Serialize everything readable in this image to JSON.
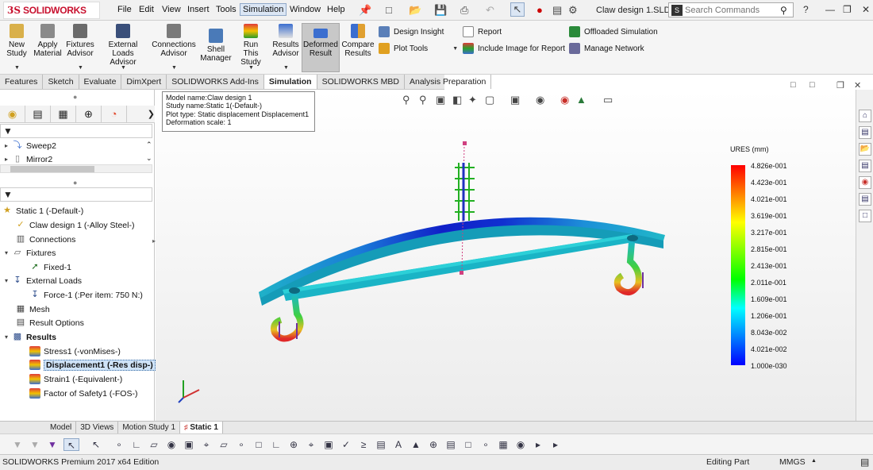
{
  "app": {
    "brand": "SOLIDWORKS",
    "brand_prefix": "3S",
    "document_title": "Claw design 1.SLD..."
  },
  "menu": [
    "File",
    "Edit",
    "View",
    "Insert",
    "Tools",
    "Simulation",
    "Window",
    "Help"
  ],
  "menu_active": "Simulation",
  "search": {
    "placeholder": "Search Commands"
  },
  "command_manager": {
    "tools": [
      {
        "label_1": "New",
        "label_2": "Study"
      },
      {
        "label_1": "Apply",
        "label_2": "Material"
      },
      {
        "label_1": "Fixtures",
        "label_2": "Advisor"
      },
      {
        "label_1": "External Loads",
        "label_2": "Advisor"
      },
      {
        "label_1": "Connections",
        "label_2": "Advisor"
      },
      {
        "label_1": "Shell",
        "label_2": "Manager"
      },
      {
        "label_1": "Run This",
        "label_2": "Study"
      },
      {
        "label_1": "Results",
        "label_2": "Advisor"
      },
      {
        "label_1": "Deformed",
        "label_2": "Result"
      },
      {
        "label_1": "Compare",
        "label_2": "Results"
      }
    ],
    "small_tools": [
      "Design Insight",
      "Plot Tools",
      "Report",
      "Include Image for Report",
      "Offloaded Simulation",
      "Manage Network"
    ]
  },
  "tabs": [
    "Features",
    "Sketch",
    "Evaluate",
    "DimXpert",
    "SOLIDWORKS Add-Ins",
    "Simulation",
    "SOLIDWORKS MBD",
    "Analysis Preparation"
  ],
  "tab_active": "Simulation",
  "feature_tree_top": [
    "Sweep2",
    "Mirror2"
  ],
  "sim_tree": {
    "study": "Static 1 (-Default-)",
    "part": "Claw design 1 (-Alloy Steel-)",
    "connections": "Connections",
    "fixtures": "Fixtures",
    "fixture_item": "Fixed-1",
    "external_loads": "External Loads",
    "load_item": "Force-1 (:Per item: 750 N:)",
    "mesh": "Mesh",
    "result_options": "Result Options",
    "results": "Results",
    "result_items": [
      "Stress1 (-vonMises-)",
      "Displacement1 (-Res disp-)",
      "Strain1 (-Equivalent-)",
      "Factor of Safety1 (-FOS-)"
    ],
    "selected_result": "Displacement1 (-Res disp-)"
  },
  "plot_info": {
    "line1": "Model name:Claw design 1",
    "line2": "Study name:Static 1(-Default-)",
    "line3": "Plot type: Static displacement Displacement1",
    "line4": "Deformation scale: 1"
  },
  "legend": {
    "title": "URES (mm)",
    "ticks": [
      "4.826e-001",
      "4.423e-001",
      "4.021e-001",
      "3.619e-001",
      "3.217e-001",
      "2.815e-001",
      "2.413e-001",
      "2.011e-001",
      "1.609e-001",
      "1.206e-001",
      "8.043e-002",
      "4.021e-002",
      "1.000e-030"
    ],
    "colors": [
      "#ff0000",
      "#ff8000",
      "#ffff00",
      "#80ff00",
      "#00ff00",
      "#00ffff",
      "#0080ff",
      "#0000ff"
    ]
  },
  "bottom_tabs": [
    "Model",
    "3D Views",
    "Motion Study 1",
    "Static 1"
  ],
  "bottom_tab_active": "Static 1",
  "status": {
    "edition": "SOLIDWORKS Premium 2017 x64 Edition",
    "mode": "Editing Part",
    "units": "MMGS"
  }
}
